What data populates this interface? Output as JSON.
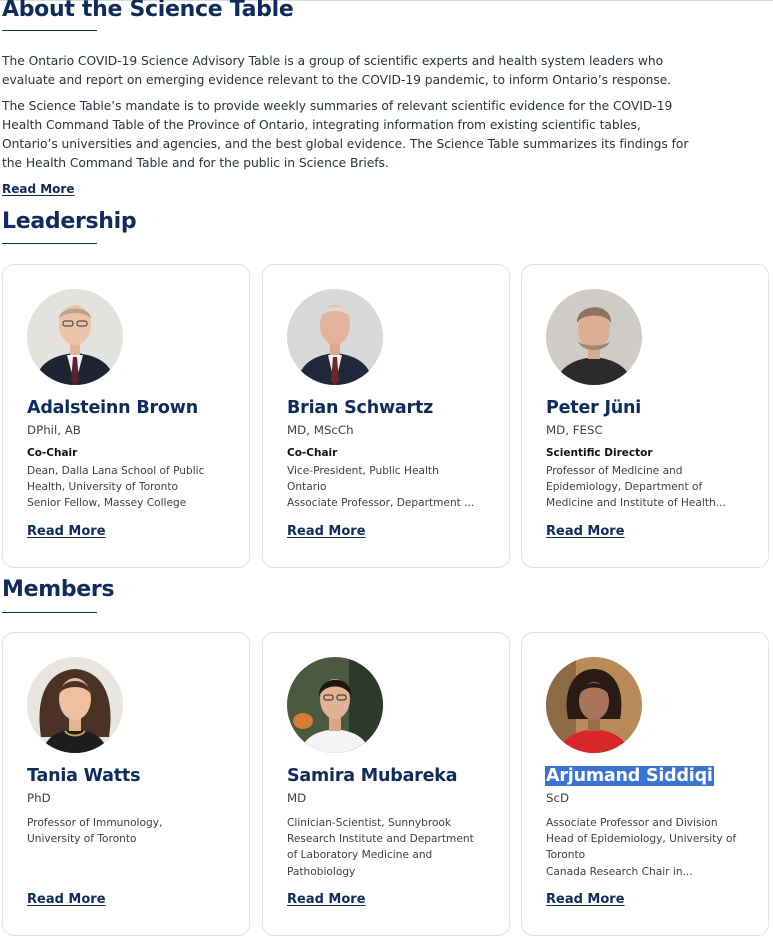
{
  "about": {
    "heading": "About the Science Table",
    "paragraph1_lines": [
      "The Ontario COVID-19 Science Advisory Table is a group of scientific experts and health system leaders who",
      "evaluate and report on emerging evidence relevant to the COVID-19 pandemic, to inform Ontario’s response."
    ],
    "paragraph2_lines": [
      "The Science Table’s mandate is to provide weekly summaries of relevant scientific evidence for the COVID-19",
      "Health Command Table of the Province of Ontario, integrating information from existing scientific tables,",
      "Ontario’s universities and agencies, and the best global evidence. The Science Table summarizes its findings for",
      "the Health Command Table and for the public in Science Briefs."
    ],
    "read_more": "Read More"
  },
  "leadership": {
    "heading": "Leadership",
    "cards": [
      {
        "name": "Adalsteinn Brown",
        "credentials": "DPhil, AB",
        "role": "Co-Chair",
        "description_lines": [
          "Dean, Dalla Lana School of Public",
          "Health, University of Toronto",
          "Senior Fellow, Massey College"
        ],
        "read_more": "Read More"
      },
      {
        "name": "Brian Schwartz",
        "credentials": "MD, MScCh",
        "role": "Co-Chair",
        "description_lines": [
          "Vice-President, Public Health",
          "Ontario",
          "Associate Professor, Department ..."
        ],
        "read_more": "Read More"
      },
      {
        "name": "Peter Jüni",
        "credentials": "MD, FESC",
        "role": "Scientific Director",
        "description_lines": [
          "Professor of Medicine and",
          "Epidemiology, Department of",
          "Medicine and Institute of Health..."
        ],
        "read_more": "Read More"
      }
    ]
  },
  "members": {
    "heading": "Members",
    "cards": [
      {
        "name": "Tania Watts",
        "credentials": "PhD",
        "description_lines": [
          "Professor of Immunology,",
          "University of Toronto"
        ],
        "read_more": "Read More"
      },
      {
        "name": "Samira Mubareka",
        "credentials": "MD",
        "description_lines": [
          "Clinician-Scientist, Sunnybrook",
          "Research Institute and Department",
          "of Laboratory Medicine and",
          "Pathobiology"
        ],
        "read_more": "Read More"
      },
      {
        "name": "Arjumand Siddiqi",
        "credentials": "ScD",
        "description_lines": [
          "Associate Professor and Division",
          "Head of Epidemiology, University of",
          "Toronto",
          "Canada Research Chair in..."
        ],
        "read_more": "Read More"
      }
    ]
  },
  "colors": {
    "heading_navy": "#0e2b5c",
    "selection_highlight": "#3b73d4"
  }
}
